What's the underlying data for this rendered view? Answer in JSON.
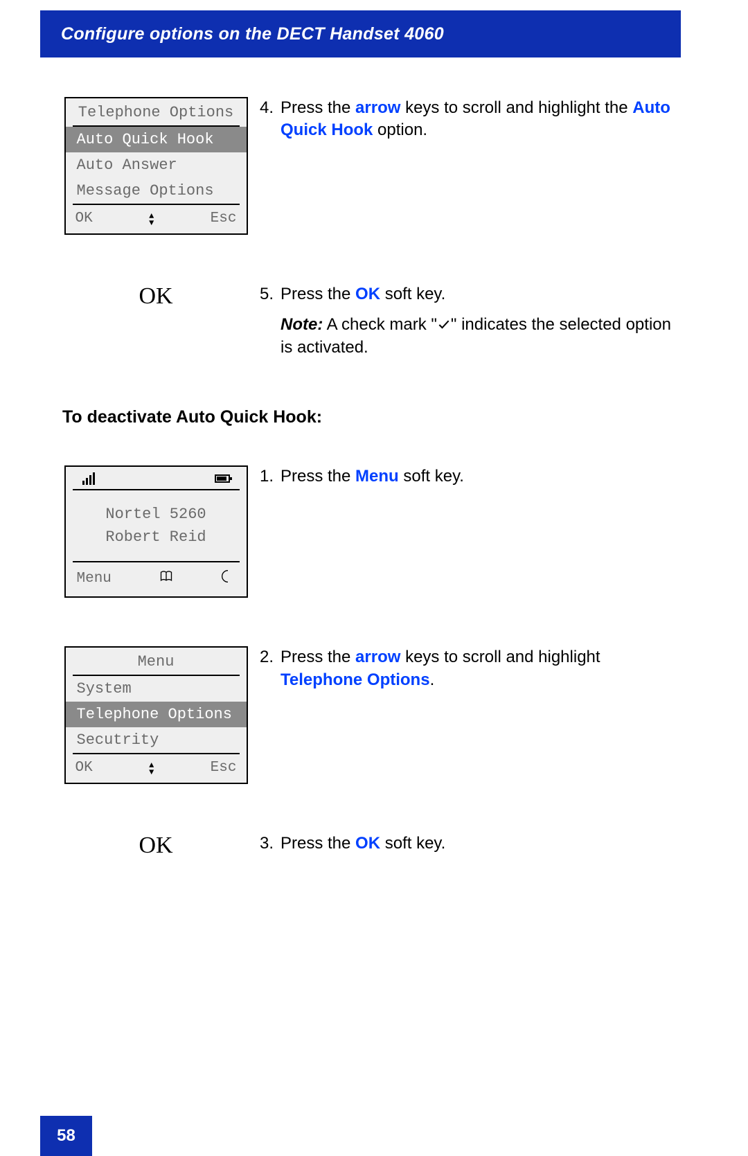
{
  "header": {
    "title": "Configure options on the DECT Handset 4060"
  },
  "footer": {
    "page_number": "58"
  },
  "step4": {
    "num": "4.",
    "pre": "Press the ",
    "arrow": "arrow",
    "mid": " keys to scroll and highlight the ",
    "hook": "Auto Quick Hook",
    "post": " option."
  },
  "screen1": {
    "title": "Telephone Options",
    "items": [
      "Auto Quick Hook",
      "Auto Answer",
      "Message Options"
    ],
    "soft_left": "OK",
    "soft_right": "Esc"
  },
  "step5": {
    "ok_label": "OK",
    "num": "5.",
    "pre": "Press the ",
    "ok": "OK",
    "post": " soft key.",
    "note_label": "Note:",
    "note_pre": " A check mark \"",
    "note_post": "\" indicates the selected option is activated."
  },
  "subheader": "To deactivate Auto Quick Hook:",
  "step1": {
    "num": "1.",
    "pre": "Press the ",
    "menu": "Menu",
    "post": " soft key."
  },
  "screen2": {
    "line1": "Nortel 5260",
    "line2": "Robert Reid",
    "soft_left": "Menu"
  },
  "step2": {
    "num": "2.",
    "pre": "Press the ",
    "arrow": "arrow",
    "mid": " keys to scroll and highlight ",
    "telopt": "Telephone Options",
    "post": "."
  },
  "screen3": {
    "title": "Menu",
    "items": [
      "System",
      "Telephone Options",
      "Secutrity"
    ],
    "soft_left": "OK",
    "soft_right": "Esc"
  },
  "step3": {
    "ok_label": "OK",
    "num": "3.",
    "pre": "Press the ",
    "ok": "OK",
    "post": " soft key."
  }
}
